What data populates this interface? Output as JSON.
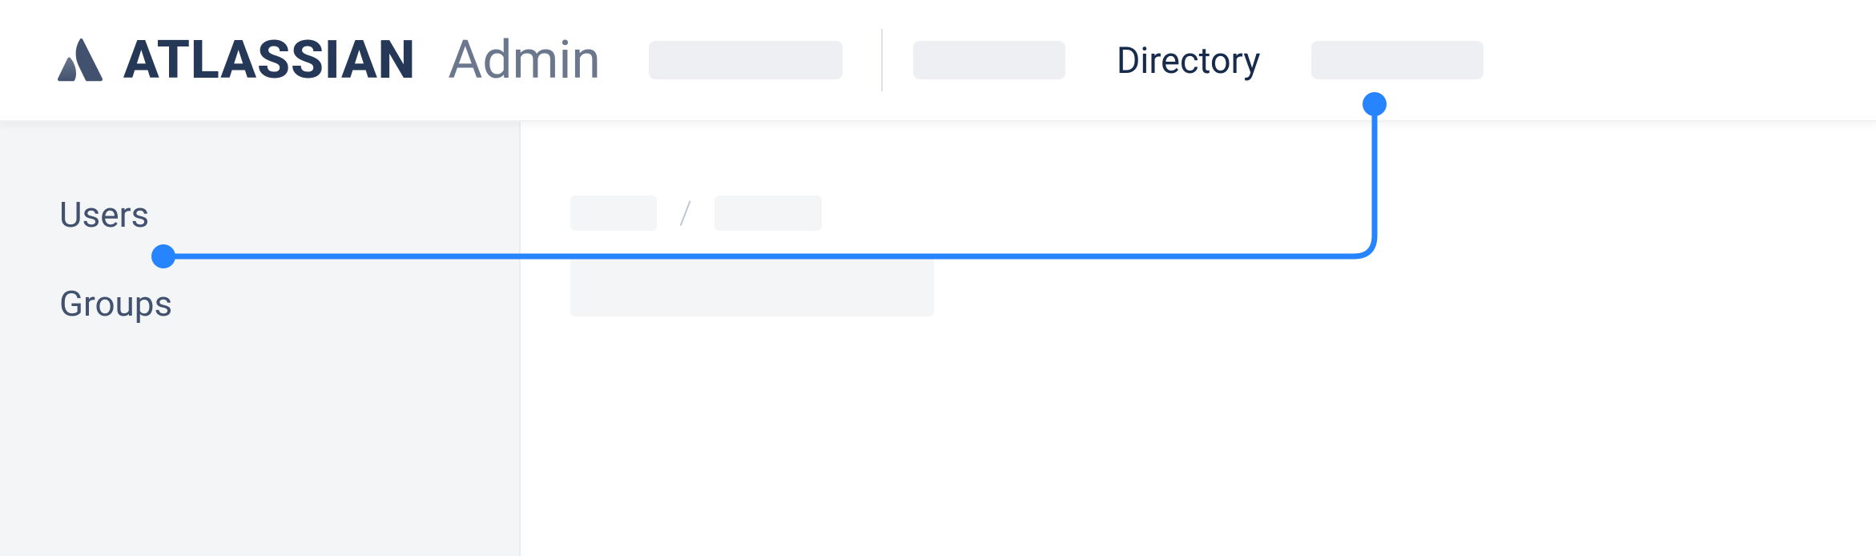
{
  "brand": {
    "logo_name": "atlassian-logo",
    "name": "ATLASSIAN",
    "sub": "Admin"
  },
  "nav": {
    "directory_label": "Directory"
  },
  "sidebar": {
    "users_label": "Users",
    "groups_label": "Groups"
  },
  "breadcrumb": {
    "separator": "/"
  },
  "annotation": {
    "color": "#2684FF"
  }
}
